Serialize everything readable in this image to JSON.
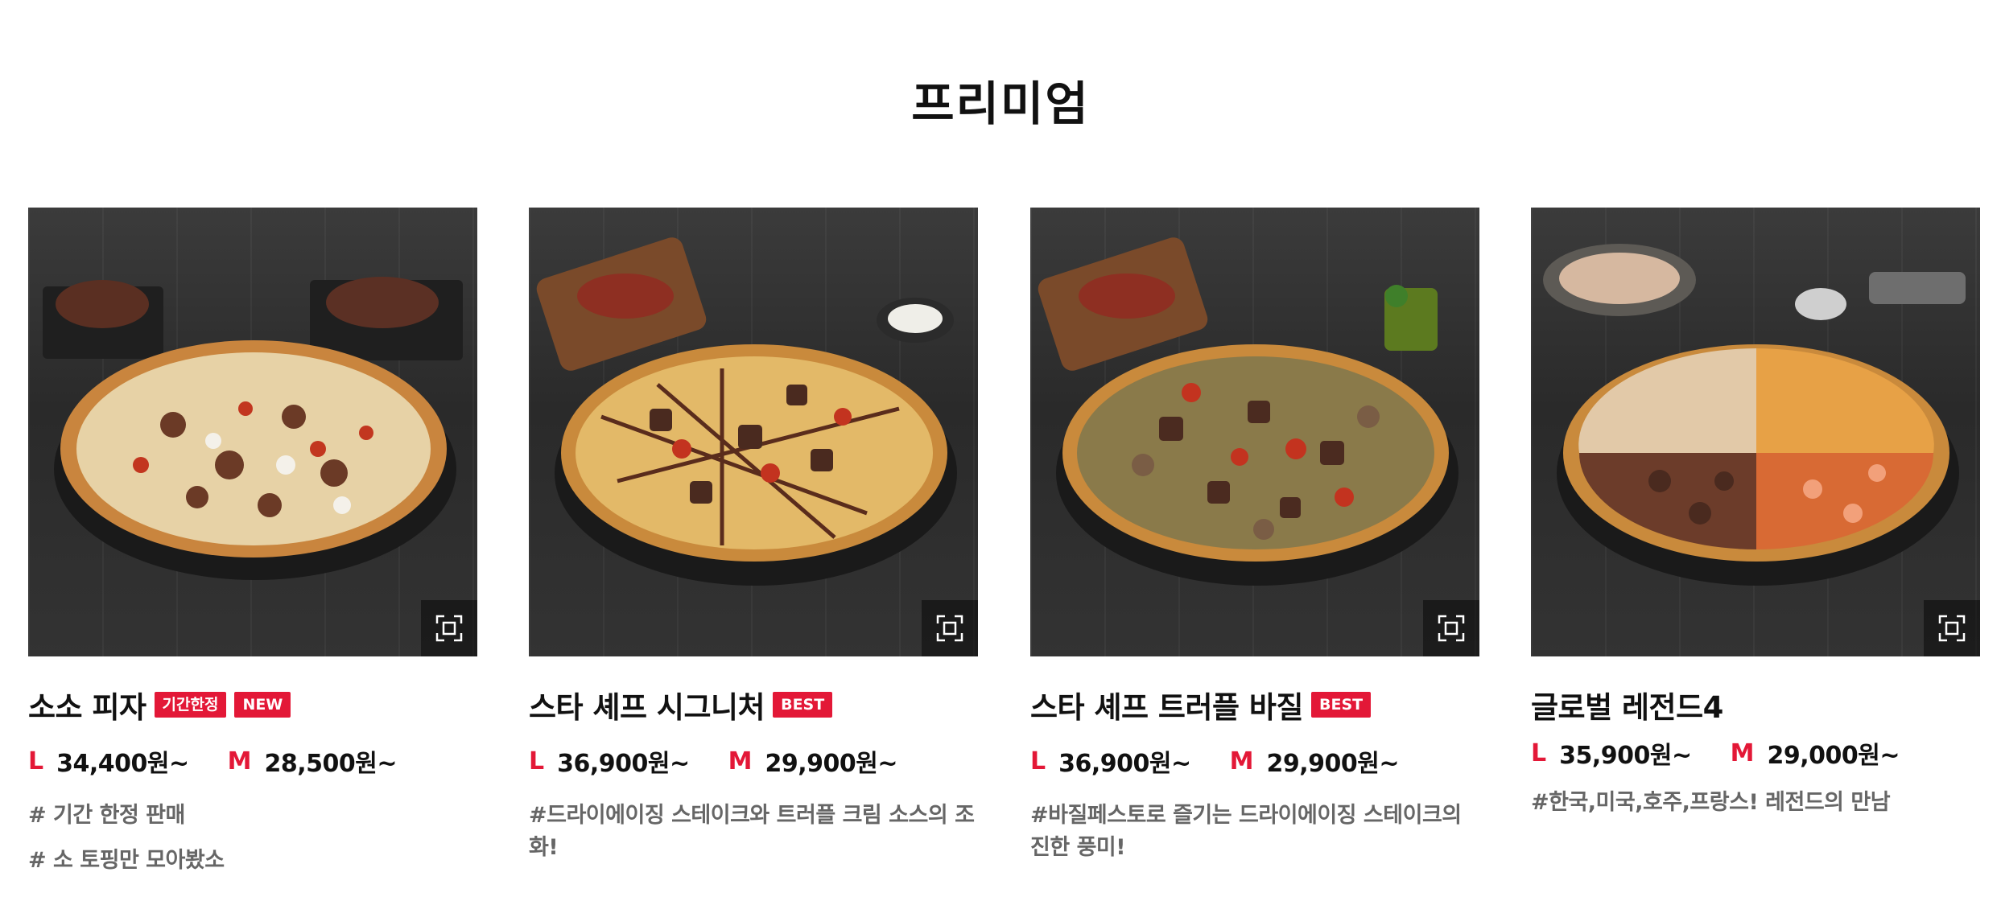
{
  "section": {
    "title": "프리미엄"
  },
  "products": [
    {
      "name": "소소 피자",
      "badges": [
        "기간한정",
        "NEW"
      ],
      "prices": [
        {
          "size": "L",
          "amount": "34,400원~"
        },
        {
          "size": "M",
          "amount": "28,500원~"
        }
      ],
      "descriptions": [
        "# 기간 한정 판매",
        "# 소 토핑만 모아봤소"
      ]
    },
    {
      "name": "스타 셰프 시그니처",
      "badges": [
        "BEST"
      ],
      "prices": [
        {
          "size": "L",
          "amount": "36,900원~"
        },
        {
          "size": "M",
          "amount": "29,900원~"
        }
      ],
      "descriptions": [
        "#드라이에이징 스테이크와 트러플 크림 소스의 조화!"
      ]
    },
    {
      "name": "스타 셰프 트러플 바질",
      "badges": [
        "BEST"
      ],
      "prices": [
        {
          "size": "L",
          "amount": "36,900원~"
        },
        {
          "size": "M",
          "amount": "29,900원~"
        }
      ],
      "descriptions": [
        "#바질페스토로 즐기는 드라이에이징 스테이크의 진한 풍미!"
      ]
    },
    {
      "name": "글로벌 레전드4",
      "badges": [],
      "prices": [
        {
          "size": "L",
          "amount": "35,900원~"
        },
        {
          "size": "M",
          "amount": "29,000원~"
        }
      ],
      "descriptions": [
        "#한국,미국,호주,프랑스! 레전드의 만남"
      ]
    }
  ],
  "colors": {
    "accent": "#e31837",
    "text": "#111111",
    "muted": "#666666"
  },
  "icons": {
    "zoom": "expand-frame-icon"
  }
}
